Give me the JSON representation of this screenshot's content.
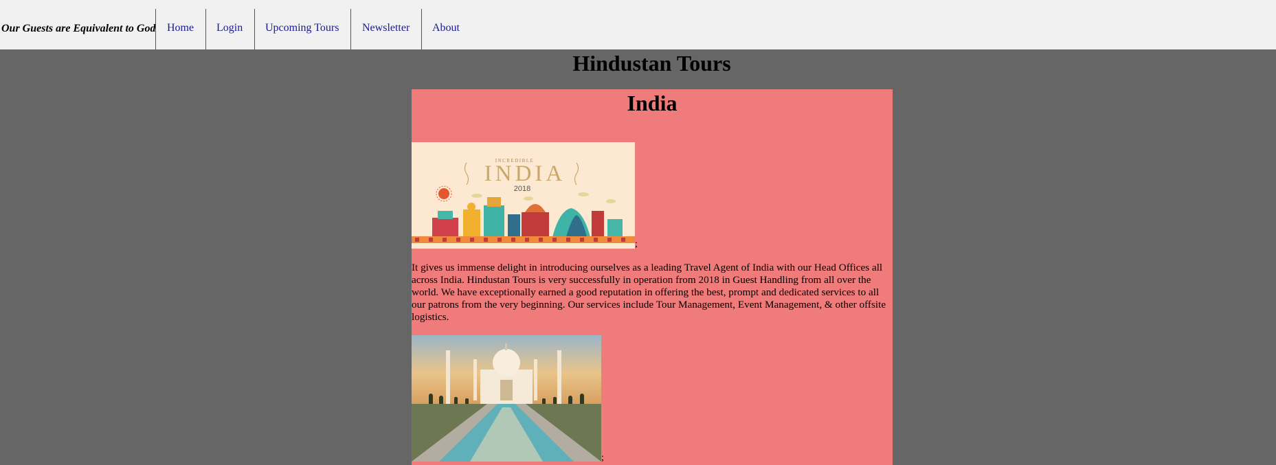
{
  "nav": {
    "tagline": "Our Guests are Equivalent to God",
    "links": [
      "Home",
      "Login",
      "Upcoming Tours",
      "Newsletter",
      "About"
    ]
  },
  "header": {
    "title": "Hindustan Tours"
  },
  "panel": {
    "title": "India",
    "banner": {
      "top_text": "INCREDIBLE",
      "title": "INDIA",
      "year": "2018"
    },
    "semicolon": ";",
    "intro": "It gives us immense delight in introducing ourselves as a leading Travel Agent of India with our Head Offices all across India. Hindustan Tours is very successfully in operation from 2018 in Guest Handling from all over the world. We have exceptionally earned a good reputation in offering the best, prompt and dedicated services to all our patrons from the very beginning. Our services include Tour Management, Event Management, & other offsite logistics."
  },
  "colors": {
    "page_bg": "#666666",
    "nav_bg": "#f1f1f1",
    "panel_bg": "#f07b7b",
    "link": "#1a1a8f"
  }
}
